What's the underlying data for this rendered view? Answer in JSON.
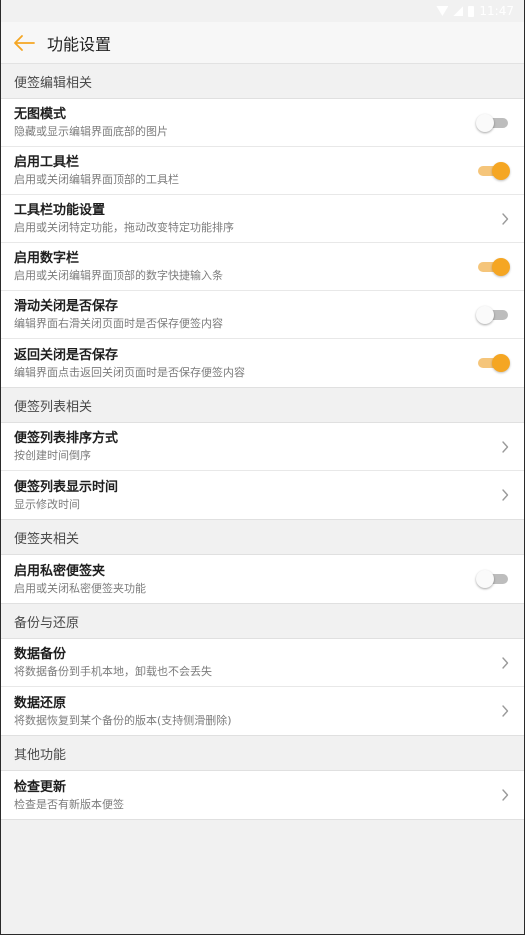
{
  "status_bar": {
    "time": "11:47"
  },
  "header": {
    "title": "功能设置",
    "accent_color": "#f5a623"
  },
  "sections": [
    {
      "title": "便签编辑相关",
      "items": [
        {
          "title": "无图模式",
          "subtitle": "隐藏或显示编辑界面底部的图片",
          "control": "toggle",
          "on": false
        },
        {
          "title": "启用工具栏",
          "subtitle": "启用或关闭编辑界面顶部的工具栏",
          "control": "toggle",
          "on": true
        },
        {
          "title": "工具栏功能设置",
          "subtitle": "启用或关闭特定功能，拖动改变特定功能排序",
          "control": "chevron"
        },
        {
          "title": "启用数字栏",
          "subtitle": "启用或关闭编辑界面顶部的数字快捷输入条",
          "control": "toggle",
          "on": true
        },
        {
          "title": "滑动关闭是否保存",
          "subtitle": "编辑界面右滑关闭页面时是否保存便签内容",
          "control": "toggle",
          "on": false
        },
        {
          "title": "返回关闭是否保存",
          "subtitle": "编辑界面点击返回关闭页面时是否保存便签内容",
          "control": "toggle",
          "on": true
        }
      ]
    },
    {
      "title": "便签列表相关",
      "items": [
        {
          "title": "便签列表排序方式",
          "subtitle": "按创建时间倒序",
          "control": "chevron"
        },
        {
          "title": "便签列表显示时间",
          "subtitle": "显示修改时间",
          "control": "chevron"
        }
      ]
    },
    {
      "title": "便签夹相关",
      "items": [
        {
          "title": "启用私密便签夹",
          "subtitle": "启用或关闭私密便签夹功能",
          "control": "toggle",
          "on": false
        }
      ]
    },
    {
      "title": "备份与还原",
      "items": [
        {
          "title": "数据备份",
          "subtitle": "将数据备份到手机本地，卸载也不会丢失",
          "control": "chevron"
        },
        {
          "title": "数据还原",
          "subtitle": "将数据恢复到某个备份的版本(支持侧滑删除)",
          "control": "chevron"
        }
      ]
    },
    {
      "title": "其他功能",
      "items": [
        {
          "title": "检查更新",
          "subtitle": "检查是否有新版本便签",
          "control": "chevron"
        }
      ]
    }
  ]
}
